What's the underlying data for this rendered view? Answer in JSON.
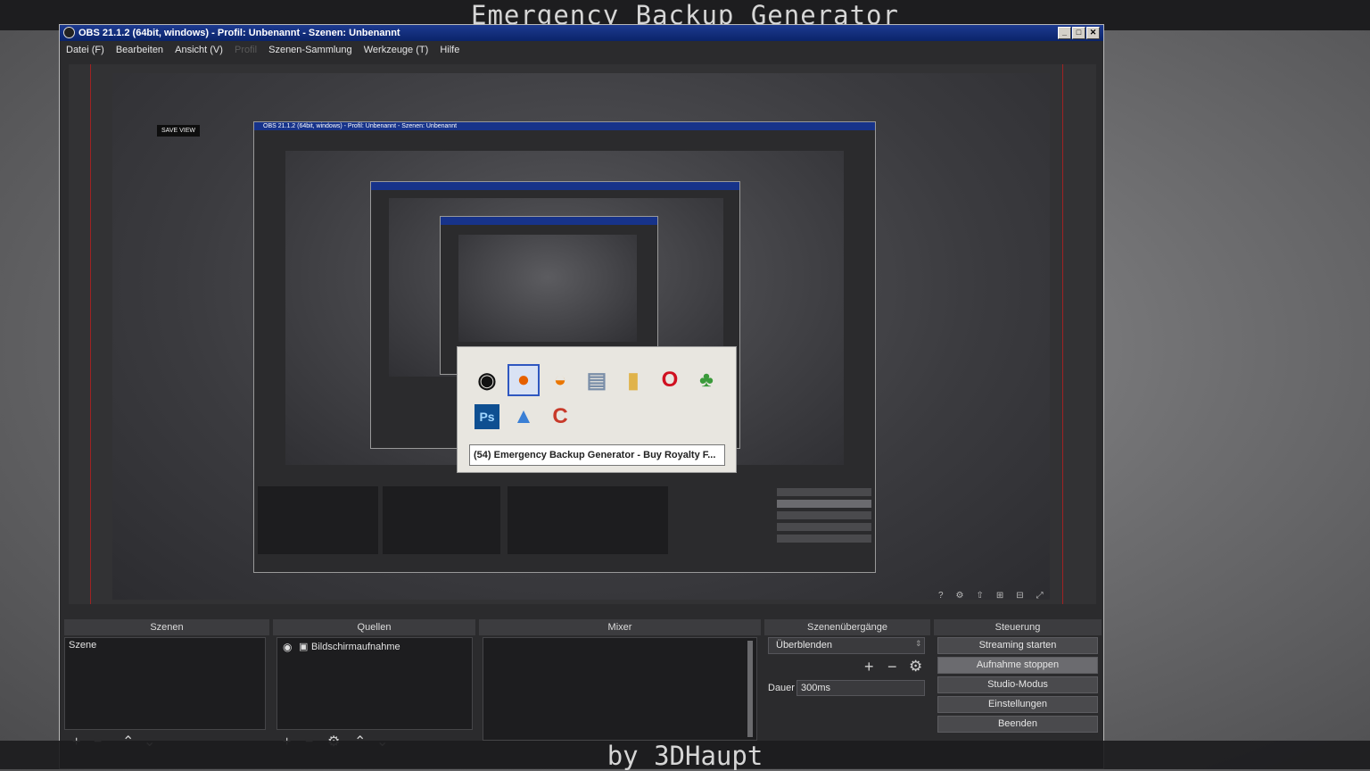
{
  "overlay": {
    "top_title": "Emergency Backup Generator",
    "bottom_caption": "by 3DHaupt"
  },
  "window": {
    "title": "OBS 21.1.2 (64bit, windows) - Profil: Unbenannt - Szenen: Unbenannt",
    "controls": [
      "_",
      "□",
      "✕"
    ]
  },
  "menu": {
    "items": [
      "Datei (F)",
      "Bearbeiten",
      "Ansicht (V)",
      "Profil",
      "Szenen-Sammlung",
      "Werkzeuge (T)",
      "Hilfe"
    ]
  },
  "preview": {
    "safe_view_label": "SAVE VIEW"
  },
  "switcher": {
    "apps": [
      "obs",
      "firefox",
      "blender",
      "installer",
      "folder",
      "opera",
      "kettle",
      "photoshop",
      "toolbox",
      "ccleaner"
    ],
    "photoshop_label": "Ps",
    "selected_app": "firefox",
    "window_label": "(54) Emergency Backup Generator - Buy Royalty F..."
  },
  "docks": {
    "scenes": {
      "header": "Szenen",
      "items": [
        "Szene"
      ]
    },
    "sources": {
      "header": "Quellen",
      "items": [
        "Bildschirmaufnahme"
      ]
    },
    "mixer": {
      "header": "Mixer"
    },
    "transitions": {
      "header": "Szenenübergänge",
      "selected": "Überblenden",
      "duration_label": "Dauer",
      "duration_value": "300ms"
    },
    "controls": {
      "header": "Steuerung",
      "buttons": [
        "Streaming starten",
        "Aufnahme stoppen",
        "Studio-Modus",
        "Einstellungen",
        "Beenden"
      ]
    }
  },
  "colors": {
    "title_bar": "#0b246a",
    "safe_line": "#a02222",
    "dock_bg": "#2b2b2d"
  }
}
